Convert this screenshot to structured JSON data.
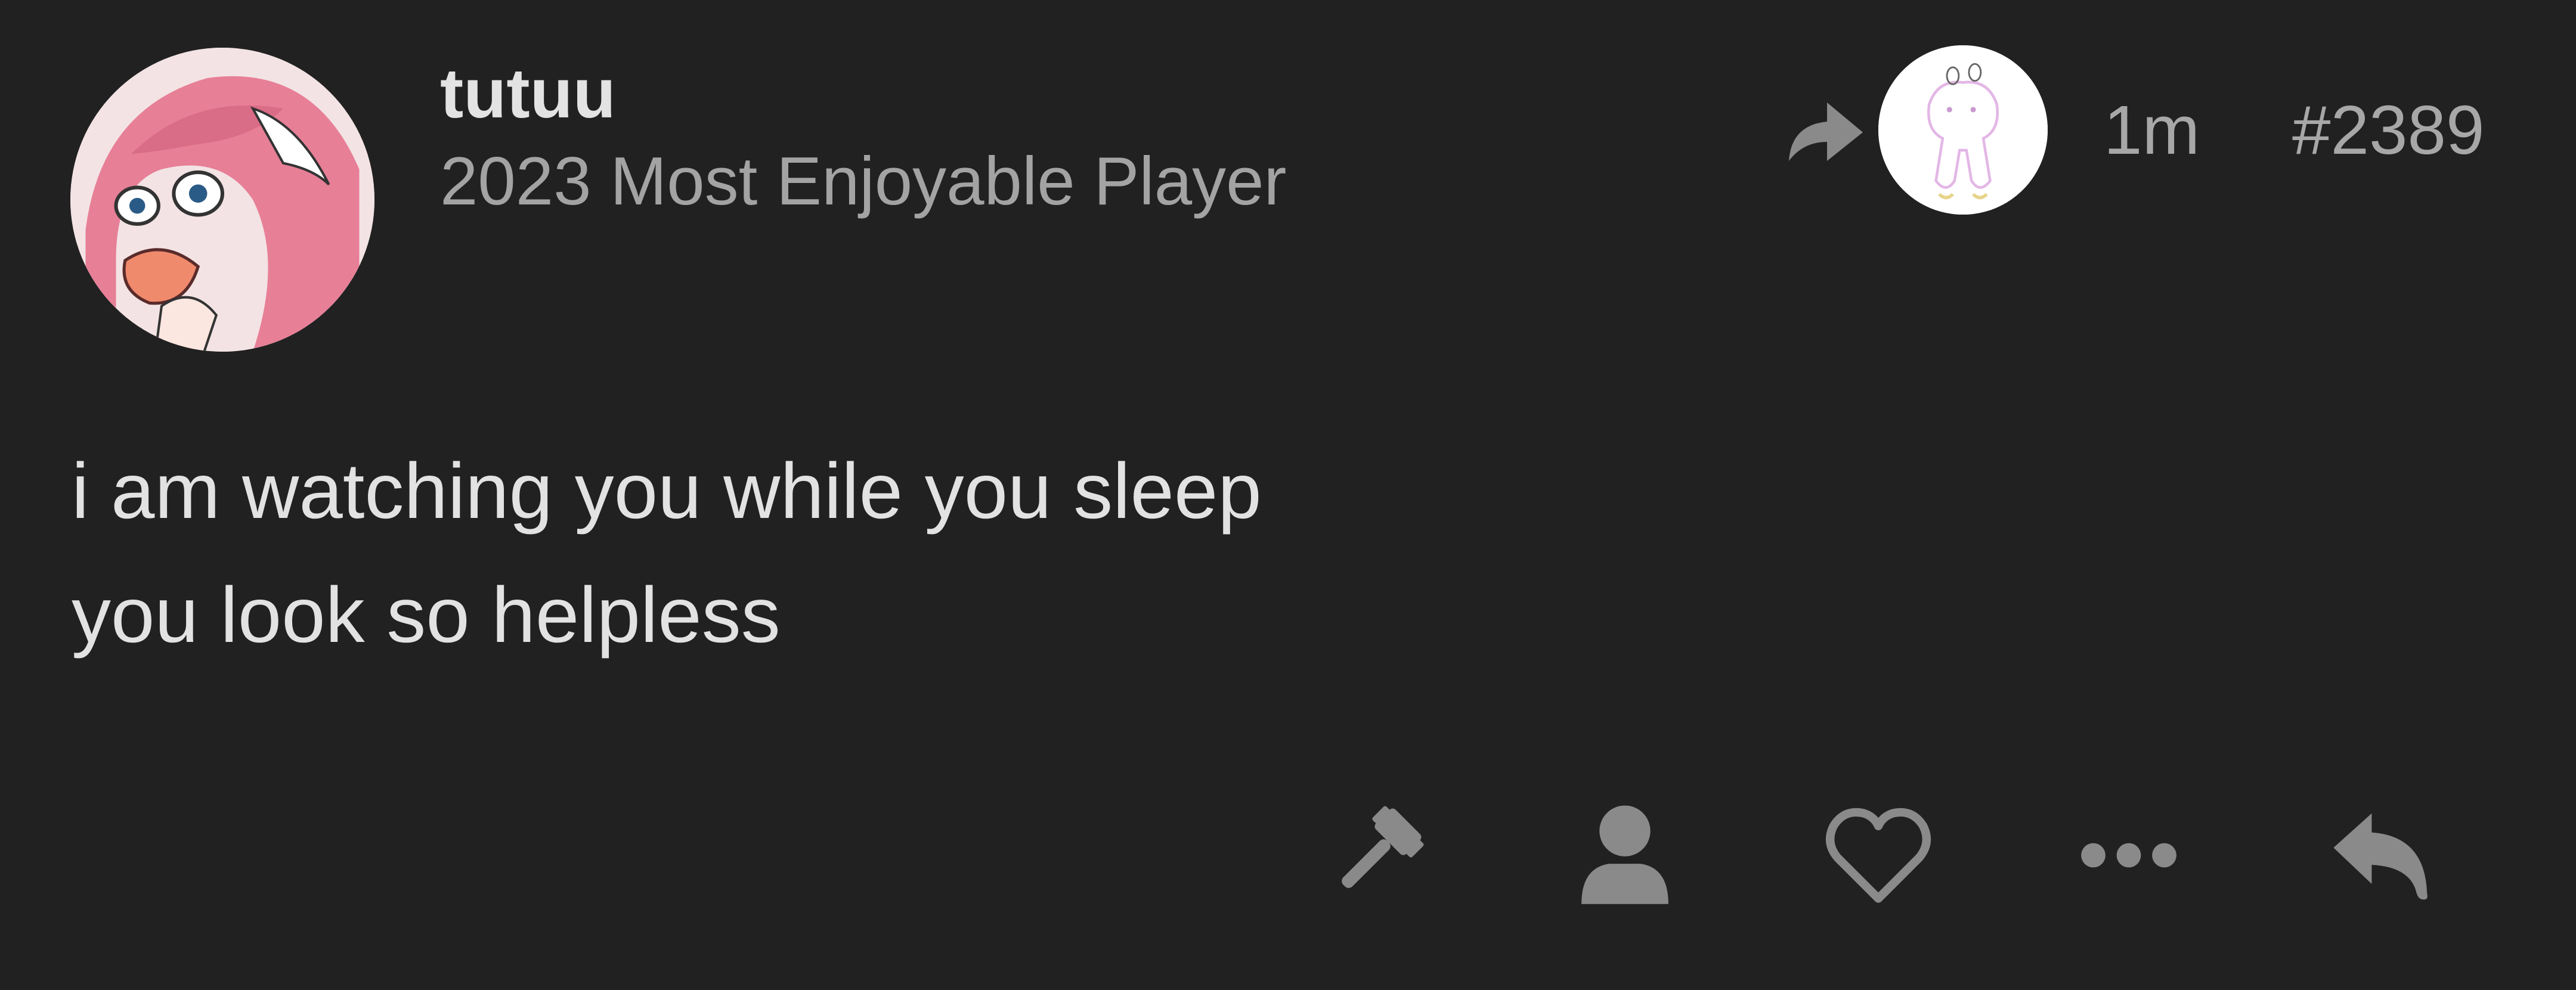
{
  "post": {
    "author": {
      "username": "tutuu",
      "title": "2023 Most Enjoyable Player",
      "avatar_icon": "anime-avatar"
    },
    "reply_target": {
      "icon": "reply-arrow-icon",
      "avatar_icon": "sketch-avatar"
    },
    "time": "1m",
    "number": "#2389",
    "body": {
      "lines": [
        "i am watching you while you sleep",
        "you look so helpless"
      ]
    },
    "actions": [
      {
        "name": "moderate",
        "icon": "gavel-icon"
      },
      {
        "name": "profile",
        "icon": "user-icon"
      },
      {
        "name": "like",
        "icon": "heart-icon"
      },
      {
        "name": "more",
        "icon": "ellipsis-icon"
      },
      {
        "name": "reply",
        "icon": "reply-icon"
      }
    ]
  },
  "colors": {
    "background": "#212121",
    "text_primary": "#e2e2e2",
    "text_secondary": "#a3a3a3",
    "icon": "#8a8a8a"
  }
}
